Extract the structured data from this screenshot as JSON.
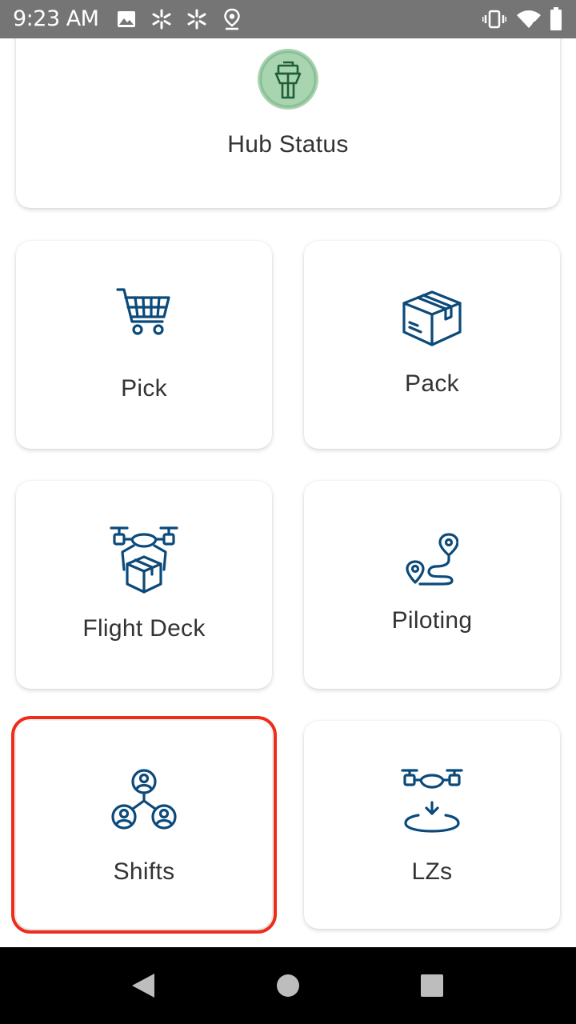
{
  "status_bar": {
    "time": "9:23 AM",
    "left_icons": [
      "image-icon",
      "walmart-spark-icon",
      "walmart-spark-icon",
      "location-icon"
    ],
    "right_icons": [
      "vibrate-icon",
      "wifi-icon",
      "battery-icon"
    ]
  },
  "tiles": {
    "hub_status": {
      "label": "Hub Status",
      "icon": "control-tower-icon"
    },
    "pick": {
      "label": "Pick",
      "icon": "shopping-cart-icon"
    },
    "pack": {
      "label": "Pack",
      "icon": "package-box-icon"
    },
    "flight_deck": {
      "label": "Flight Deck",
      "icon": "drone-package-icon"
    },
    "piloting": {
      "label": "Piloting",
      "icon": "route-icon"
    },
    "shifts": {
      "label": "Shifts",
      "icon": "team-icon"
    },
    "lzs": {
      "label": "LZs",
      "icon": "drone-landing-icon"
    }
  },
  "selected_tile": "shifts",
  "colors": {
    "icon_blue": "#0b4a7a",
    "tower_badge_green": "#a9d4b0",
    "selection_red": "#ee2d1a",
    "status_bar": "#757575"
  },
  "nav_bar": {
    "buttons": [
      "back-icon",
      "home-icon",
      "recents-icon"
    ]
  }
}
